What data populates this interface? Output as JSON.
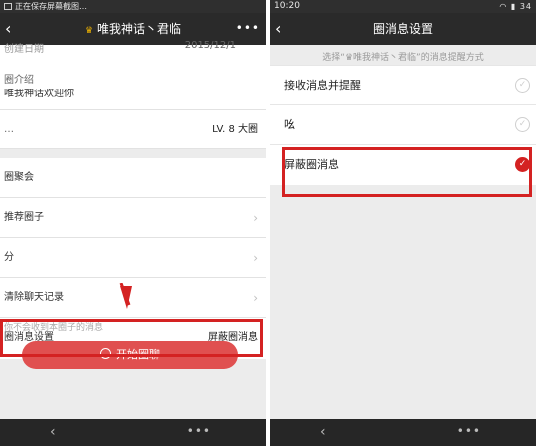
{
  "left": {
    "status_text": "正在保存屏幕截图…",
    "nav": {
      "back": "‹",
      "crown": "♛",
      "title": "唯我神话丶君临",
      "more": "•••"
    },
    "cut_top_label": "创建日期",
    "cut_top_value": "2015/12/1",
    "intro_label": "圈介绍",
    "intro_value": "唯我神话欢迎你",
    "level_label": "…",
    "level_value": "LV. 8  大圈",
    "menu": [
      {
        "label": "圈聚会",
        "chevron": ""
      },
      {
        "label": "推荐圈子",
        "chevron": "›"
      },
      {
        "label": "分",
        "chevron": "›"
      },
      {
        "label": "清除聊天记录",
        "chevron": "›"
      },
      {
        "label": "圈消息设置",
        "value": "屏蔽圈消息"
      }
    ],
    "hint": "你不会收到本圈子的消息",
    "start_button": "开始圈聊",
    "bottom": {
      "back": "‹",
      "more": "•••"
    }
  },
  "right": {
    "status": {
      "time": "10:20",
      "battery": "34"
    },
    "nav": {
      "back": "‹",
      "title": "圈消息设置"
    },
    "subtitle": "选择“♛唯我神话丶君临”的消息提醒方式",
    "options": [
      {
        "label": "接收消息并提醒",
        "checked": false
      },
      {
        "label": "吆",
        "checked": false
      },
      {
        "label": "屏蔽圈消息",
        "checked": true
      }
    ],
    "check_mark": "✓",
    "bottom": {
      "back": "‹",
      "more": "•••"
    }
  },
  "colors": {
    "accent": "#d42222",
    "button": "#e05050",
    "navbar": "#2a2a2a"
  }
}
